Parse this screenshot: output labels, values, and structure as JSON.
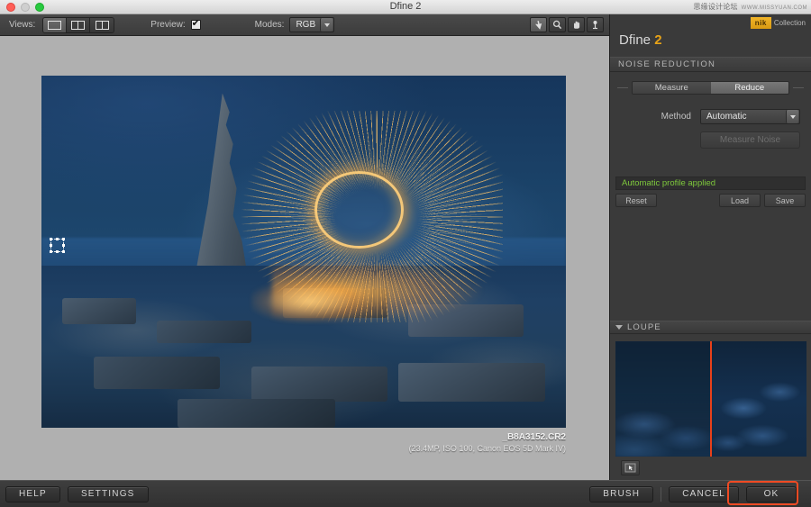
{
  "window": {
    "title": "Dfine 2",
    "traffic_lights": [
      "close",
      "minimize",
      "zoom"
    ],
    "watermark_text": "思缘设计论坛",
    "watermark_url": "WWW.MISSYUAN.COM"
  },
  "toolbar": {
    "views_label": "Views:",
    "view_buttons": [
      {
        "name": "single-view",
        "active": true
      },
      {
        "name": "split-view",
        "active": false
      },
      {
        "name": "side-by-side-view",
        "active": false
      }
    ],
    "preview_label": "Preview:",
    "preview_checked": true,
    "modes_label": "Modes:",
    "modes_value": "RGB",
    "tools": [
      {
        "name": "pointer-tool",
        "icon": "arrow-icon",
        "active": true
      },
      {
        "name": "zoom-tool",
        "icon": "magnifier-icon",
        "active": false
      },
      {
        "name": "pan-tool",
        "icon": "hand-icon",
        "active": false
      },
      {
        "name": "control-point-tool",
        "icon": "control-point-icon",
        "active": false
      }
    ]
  },
  "canvas": {
    "image_caption_file": "_B8A3152.CR2",
    "image_caption_meta": "(23.4MP, ISO 100, Canon EOS 5D Mark IV)"
  },
  "panel": {
    "app_name": "Dfine",
    "app_version": "2",
    "brand_mark": "nik",
    "brand_suffix": "Collection",
    "section_title": "NOISE REDUCTION",
    "tabs": [
      {
        "label": "Measure",
        "active": false
      },
      {
        "label": "Reduce",
        "active": true
      }
    ],
    "method_label": "Method",
    "method_value": "Automatic",
    "measure_noise_label": "Measure Noise",
    "measure_noise_enabled": false,
    "status_text": "Automatic profile applied",
    "status_color": "#7ec93c",
    "reset_label": "Reset",
    "load_label": "Load",
    "save_label": "Save",
    "loupe_title": "LOUPE",
    "loupe_tool_icon": "loupe-cursor-icon"
  },
  "bottom": {
    "help_label": "HELP",
    "settings_label": "SETTINGS",
    "brush_label": "BRUSH",
    "cancel_label": "CANCEL",
    "ok_label": "OK",
    "highlight_color": "#f04a23"
  }
}
